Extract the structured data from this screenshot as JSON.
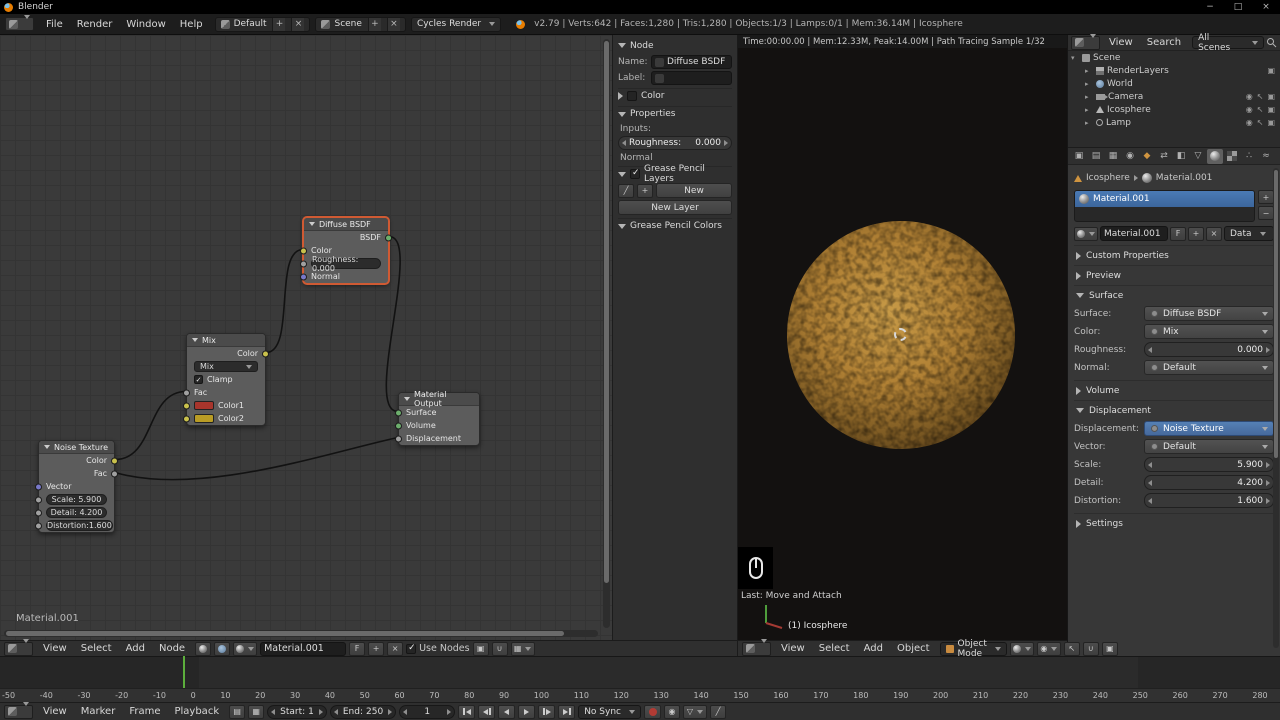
{
  "window": {
    "title": "Blender"
  },
  "infobar": {
    "menus": [
      "File",
      "Render",
      "Window",
      "Help"
    ],
    "layout": "Default",
    "scene": "Scene",
    "engine": "Cycles Render",
    "stats": "v2.79 | Verts:642 | Faces:1,280 | Tris:1,280 | Objects:1/3 | Lamps:0/1 | Mem:36.14M | Icosphere"
  },
  "node_editor": {
    "canvas_label": "Material.001",
    "nodes": {
      "diffuse": {
        "title": "Diffuse BSDF",
        "out": "BSDF",
        "color": "Color",
        "roughness": "Roughness: 0.000",
        "normal": "Normal"
      },
      "mix": {
        "title": "Mix",
        "out": "Color",
        "blend": "Mix",
        "clamp": "Clamp",
        "fac": "Fac",
        "color1": "Color1",
        "color2": "Color2"
      },
      "noise": {
        "title": "Noise Texture",
        "color": "Color",
        "fac": "Fac",
        "vector": "Vector",
        "scale": "Scale: 5.900",
        "detail": "Detail: 4.200",
        "distortion": "Distortion:1.600"
      },
      "output": {
        "title": "Material Output",
        "surface": "Surface",
        "volume": "Volume",
        "displacement": "Displacement"
      }
    },
    "n_panel": {
      "node": "Node",
      "name_label": "Name:",
      "name_value": "Diffuse BSDF",
      "label_label": "Label:",
      "color": "Color",
      "properties": "Properties",
      "inputs": "Inputs:",
      "roughness_label": "Roughness:",
      "roughness_value": "0.000",
      "normal": "Normal",
      "gp_layers": "Grease Pencil Layers",
      "new": "New",
      "new_layer": "New Layer",
      "gp_colors": "Grease Pencil Colors"
    },
    "header": {
      "menus": [
        "View",
        "Select",
        "Add",
        "Node"
      ],
      "material": "Material.001",
      "fake_user": "F",
      "use_nodes": "Use Nodes"
    }
  },
  "viewport": {
    "stats": "Time:00:00.00 | Mem:12.33M, Peak:14.00M | Path Tracing Sample 1/32",
    "last_action": "Last: Move and Attach",
    "object_info": "(1) Icosphere",
    "header": {
      "menus": [
        "View",
        "Select",
        "Add",
        "Object"
      ],
      "mode": "Object Mode"
    }
  },
  "outliner": {
    "menus": [
      "View",
      "Search"
    ],
    "filter": "All Scenes",
    "items": [
      {
        "label": "Scene"
      },
      {
        "label": "RenderLayers"
      },
      {
        "label": "World"
      },
      {
        "label": "Camera"
      },
      {
        "label": "Icosphere"
      },
      {
        "label": "Lamp"
      }
    ]
  },
  "properties": {
    "breadcrumb": {
      "object": "Icosphere",
      "material": "Material.001"
    },
    "slot": "Material.001",
    "name_value": "Material.001",
    "fake_user": "F",
    "link": "Data",
    "panels": {
      "custom_properties": "Custom Properties",
      "preview": "Preview",
      "surface": "Surface",
      "volume": "Volume",
      "displacement": "Displacement",
      "settings": "Settings"
    },
    "surface": {
      "surface_label": "Surface:",
      "surface_value": "Diffuse BSDF",
      "color_label": "Color:",
      "color_value": "Mix",
      "roughness_label": "Roughness:",
      "roughness_value": "0.000",
      "normal_label": "Normal:",
      "normal_value": "Default"
    },
    "displacement": {
      "label": "Displacement:",
      "value": "Noise Texture",
      "vector_label": "Vector:",
      "vector_value": "Default",
      "scale_label": "Scale:",
      "scale_value": "5.900",
      "detail_label": "Detail:",
      "detail_value": "4.200",
      "distortion_label": "Distortion:",
      "distortion_value": "1.600"
    }
  },
  "timeline": {
    "menus": [
      "View",
      "Marker",
      "Frame",
      "Playback"
    ],
    "start_label": "Start:",
    "start_value": "1",
    "end_label": "End:",
    "end_value": "250",
    "current_frame": "1",
    "sync": "No Sync",
    "ruler": [
      "-50",
      "-40",
      "-30",
      "-20",
      "-10",
      "0",
      "10",
      "20",
      "30",
      "40",
      "50",
      "60",
      "70",
      "80",
      "90",
      "100",
      "110",
      "120",
      "130",
      "140",
      "150",
      "160",
      "170",
      "180",
      "190",
      "200",
      "210",
      "220",
      "230",
      "240",
      "250",
      "260",
      "270",
      "280"
    ]
  }
}
